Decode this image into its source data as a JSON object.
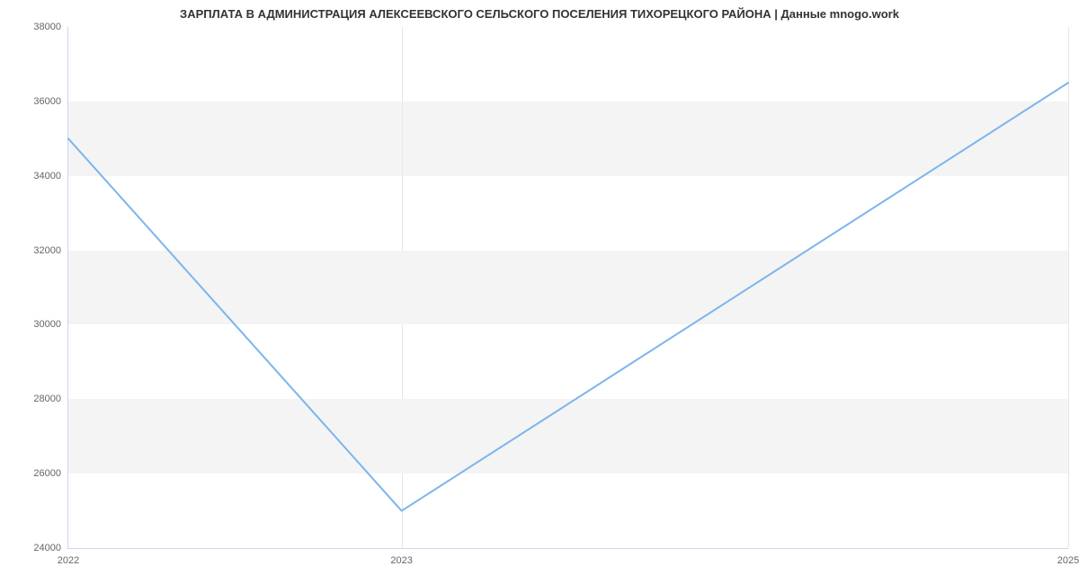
{
  "chart_data": {
    "type": "line",
    "title": "ЗАРПЛАТА В АДМИНИСТРАЦИЯ АЛЕКСЕЕВСКОГО СЕЛЬСКОГО ПОСЕЛЕНИЯ ТИХОРЕЦКОГО РАЙОНА | Данные mnogo.work",
    "x": [
      2022,
      2023,
      2025
    ],
    "values": [
      35000,
      25000,
      36500
    ],
    "xlabel": "",
    "ylabel": "",
    "x_ticks": [
      2022,
      2023,
      2025
    ],
    "y_ticks": [
      24000,
      26000,
      28000,
      30000,
      32000,
      34000,
      36000,
      38000
    ],
    "ylim": [
      24000,
      38000
    ],
    "xlim": [
      2022,
      2025
    ],
    "line_color": "#7cb5ec",
    "band_color": "#f4f4f4"
  }
}
